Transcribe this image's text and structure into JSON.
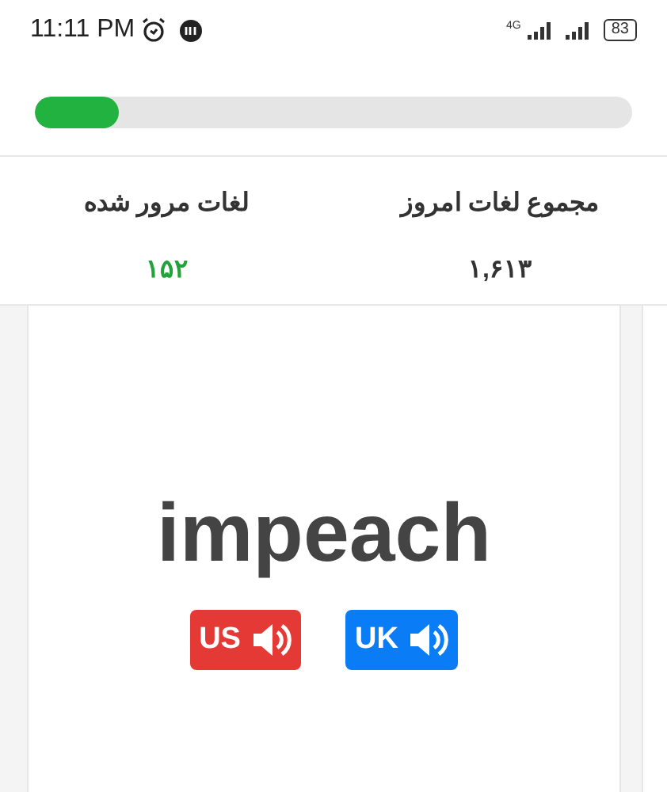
{
  "status_bar": {
    "time": "11:11 PM",
    "network": "4G",
    "battery": "83"
  },
  "progress": {
    "level": 0.14
  },
  "stats": [
    {
      "label": "مجموع لغات امروز",
      "value": "۱,۶۱۳",
      "kind": "total"
    },
    {
      "label": "لغات مرور شده",
      "value": "۱۵۲",
      "kind": "reviewed"
    }
  ],
  "card": {
    "word": "impeach",
    "us_button": {
      "label": "US",
      "color": "#e53935"
    },
    "uk_button": {
      "label": "UK",
      "color": "#0a7cf5"
    }
  }
}
